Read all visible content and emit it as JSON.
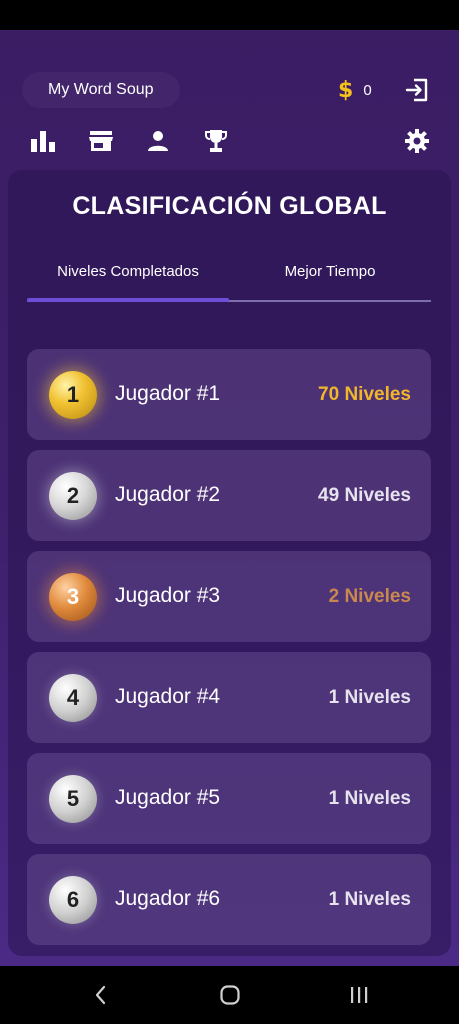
{
  "header": {
    "app_name": "My Word Soup",
    "coins": "0",
    "coin_symbol": "$"
  },
  "nav": {
    "items": [
      {
        "icon": "bar-chart-icon"
      },
      {
        "icon": "store-icon"
      },
      {
        "icon": "profile-icon"
      },
      {
        "icon": "trophy-icon"
      },
      {
        "icon": "gear-icon"
      }
    ]
  },
  "leaderboard": {
    "title": "CLASIFICACIÓN GLOBAL",
    "tabs": [
      {
        "label": "Niveles Completados",
        "active": true
      },
      {
        "label": "Mejor Tiempo",
        "active": false
      }
    ],
    "rows": [
      {
        "rank": "1",
        "player": "Jugador #1",
        "levels": "70 Niveles",
        "medal": "gold"
      },
      {
        "rank": "2",
        "player": "Jugador #2",
        "levels": "49 Niveles",
        "medal": "silver"
      },
      {
        "rank": "3",
        "player": "Jugador #3",
        "levels": "2 Niveles",
        "medal": "bronze"
      },
      {
        "rank": "4",
        "player": "Jugador #4",
        "levels": "1 Niveles",
        "medal": "plain"
      },
      {
        "rank": "5",
        "player": "Jugador #5",
        "levels": "1 Niveles",
        "medal": "plain"
      },
      {
        "rank": "6",
        "player": "Jugador #6",
        "levels": "1 Niveles",
        "medal": "plain"
      }
    ]
  },
  "colors": {
    "accent": "#6c4fd6",
    "gold": "#f2b62a",
    "bronze": "#c98850",
    "coin": "#f5c21b"
  }
}
